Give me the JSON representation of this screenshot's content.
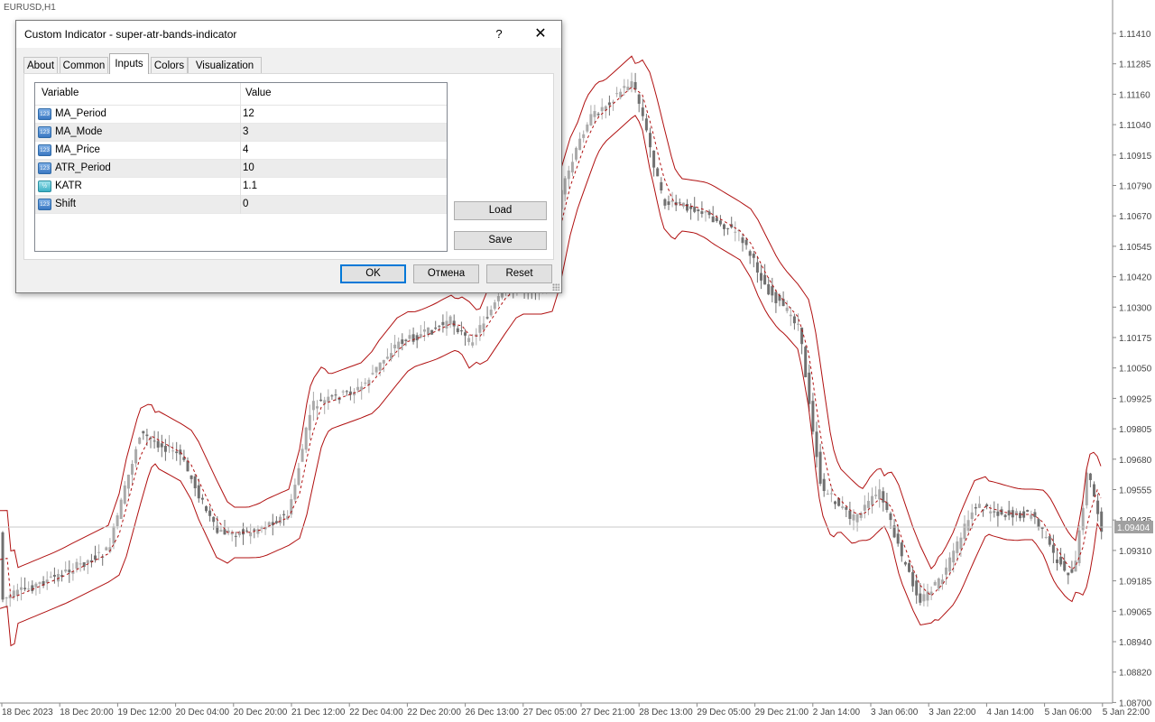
{
  "chart": {
    "symbol": "EURUSD,H1",
    "current_price": "1.09404",
    "price_labels": [
      "1.11410",
      "1.11285",
      "1.11160",
      "1.11040",
      "1.10915",
      "1.10790",
      "1.10670",
      "1.10545",
      "1.10420",
      "1.10300",
      "1.10175",
      "1.10050",
      "1.09925",
      "1.09805",
      "1.09680",
      "1.09555",
      "1.09435",
      "1.09310",
      "1.09185",
      "1.09065",
      "1.08940",
      "1.08820",
      "1.08700"
    ],
    "time_labels": [
      "18 Dec 2023",
      "18 Dec 20:00",
      "19 Dec 12:00",
      "20 Dec 04:00",
      "20 Dec 20:00",
      "21 Dec 12:00",
      "22 Dec 04:00",
      "22 Dec 20:00",
      "26 Dec 13:00",
      "27 Dec 05:00",
      "27 Dec 21:00",
      "28 Dec 13:00",
      "29 Dec 05:00",
      "29 Dec 21:00",
      "2 Jan 14:00",
      "3 Jan 06:00",
      "3 Jan 22:00",
      "4 Jan 14:00",
      "5 Jan 06:00",
      "5 Jan 22:00"
    ],
    "colors": {
      "band": "#b01010",
      "ma": "#b01010",
      "candle_up": "#aaaaaa",
      "candle_down": "#707070"
    }
  },
  "dialog": {
    "title": "Custom Indicator - super-atr-bands-indicator",
    "help": "?",
    "close": "✕",
    "tabs": [
      {
        "label": "About"
      },
      {
        "label": "Common"
      },
      {
        "label": "Inputs"
      },
      {
        "label": "Colors"
      },
      {
        "label": "Visualization"
      }
    ],
    "active_tab": "Inputs",
    "columns": {
      "variable": "Variable",
      "value": "Value"
    },
    "inputs": [
      {
        "icon": "123",
        "variable": "MA_Period",
        "value": "12"
      },
      {
        "icon": "123",
        "variable": "MA_Mode",
        "value": "3"
      },
      {
        "icon": "123",
        "variable": "MA_Price",
        "value": "4"
      },
      {
        "icon": "123",
        "variable": "ATR_Period",
        "value": "10"
      },
      {
        "icon": "½",
        "variable": "KATR",
        "value": "1.1"
      },
      {
        "icon": "123",
        "variable": "Shift",
        "value": "0"
      }
    ],
    "buttons": {
      "load": "Load",
      "save": "Save",
      "ok": "OK",
      "cancel": "Отмена",
      "reset": "Reset"
    }
  }
}
